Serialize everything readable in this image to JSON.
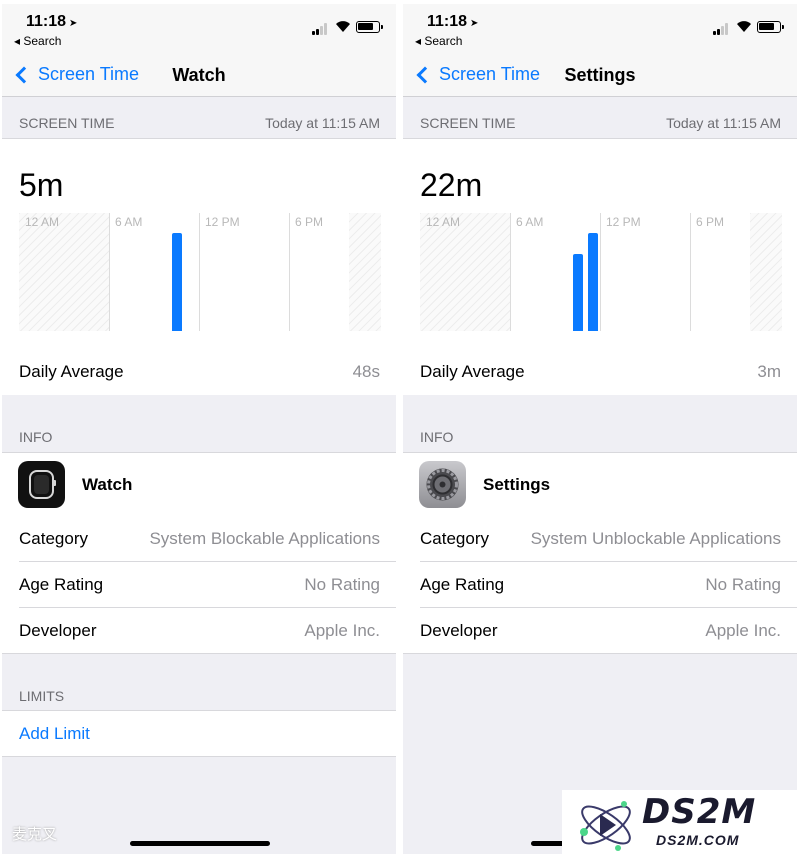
{
  "status_bar": {
    "time": "11:18",
    "back_label": "◂ Search"
  },
  "left": {
    "nav": {
      "back_label": "Screen Time",
      "title": "Watch"
    },
    "screen_time_header": "SCREEN TIME",
    "timestamp": "Today at 11:15 AM",
    "total": "5m",
    "chart_ticks": [
      "12 AM",
      "6 AM",
      "12 PM",
      "6 PM"
    ],
    "daily_average_label": "Daily Average",
    "daily_average_value": "48s",
    "info_header": "INFO",
    "app_name": "Watch",
    "category_label": "Category",
    "category_value": "System Blockable Applications",
    "age_label": "Age Rating",
    "age_value": "No Rating",
    "developer_label": "Developer",
    "developer_value": "Apple Inc.",
    "limits_header": "LIMITS",
    "add_limit": "Add Limit",
    "watermark": "麦克叉"
  },
  "right": {
    "nav": {
      "back_label": "Screen Time",
      "title": "Settings"
    },
    "screen_time_header": "SCREEN TIME",
    "timestamp": "Today at 11:15 AM",
    "total": "22m",
    "chart_ticks": [
      "12 AM",
      "6 AM",
      "12 PM",
      "6 PM"
    ],
    "daily_average_label": "Daily Average",
    "daily_average_value": "3m",
    "info_header": "INFO",
    "app_name": "Settings",
    "category_label": "Category",
    "category_value": "System Unblockable Applications",
    "age_label": "Age Rating",
    "age_value": "No Rating",
    "developer_label": "Developer",
    "developer_value": "Apple Inc."
  },
  "chart_data": [
    {
      "type": "bar",
      "x_axis_ticks": [
        "12 AM",
        "6 AM",
        "12 PM",
        "6 PM"
      ],
      "series": [
        {
          "values": [
            {
              "hour": 10,
              "level": 0.83
            }
          ]
        }
      ],
      "color": "#0a7aff"
    },
    {
      "type": "bar",
      "x_axis_ticks": [
        "12 AM",
        "6 AM",
        "12 PM",
        "6 PM"
      ],
      "series": [
        {
          "values": [
            {
              "hour": 10,
              "level": 0.65
            },
            {
              "hour": 11,
              "level": 0.83
            }
          ]
        }
      ],
      "color": "#0a7aff"
    }
  ],
  "logo": {
    "brand": "DS2M",
    "domain": "DS2M.COM"
  },
  "colors": {
    "accent": "#0a7aff",
    "background": "#efeff4",
    "secondary_text": "#8e8e93"
  }
}
